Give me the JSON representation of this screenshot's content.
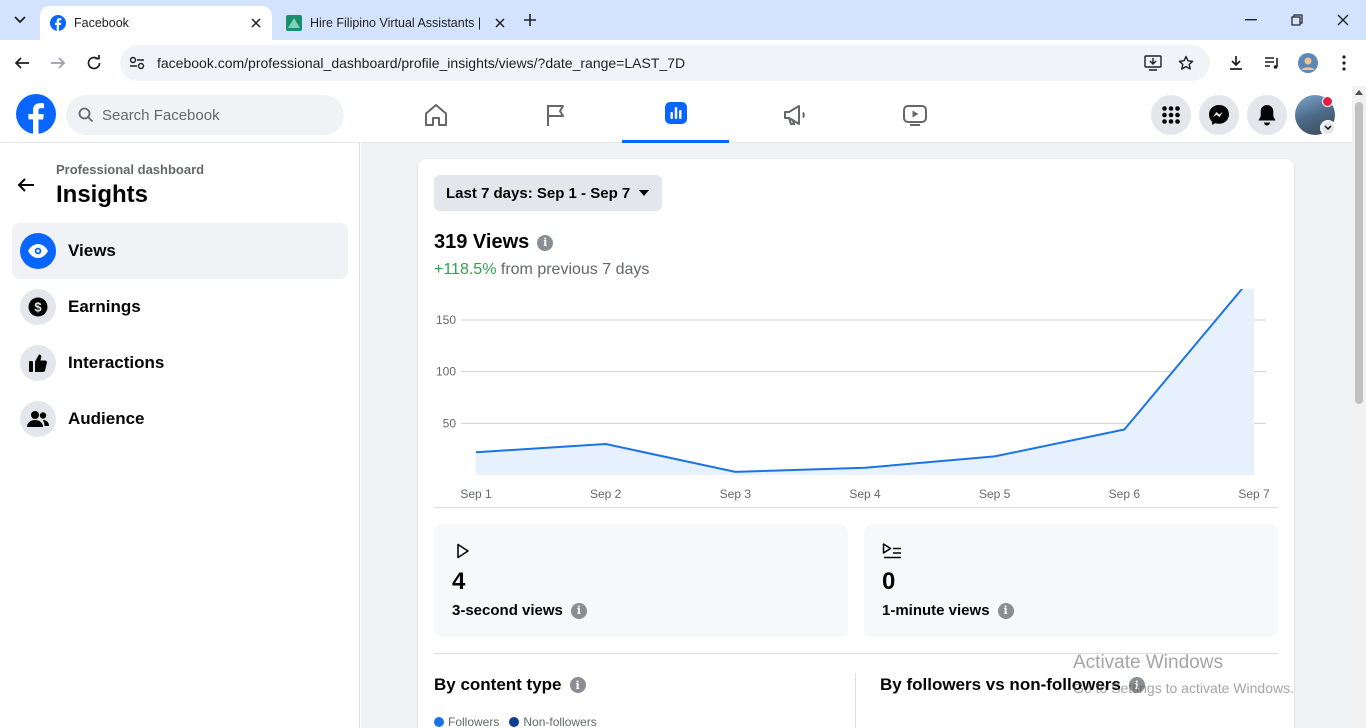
{
  "browser": {
    "tabs": [
      {
        "title": "Facebook",
        "active": true
      },
      {
        "title": "Hire Filipino Virtual Assistants |",
        "active": false
      }
    ],
    "url": "facebook.com/professional_dashboard/profile_insights/views/?date_range=LAST_7D"
  },
  "fb_header": {
    "search_placeholder": "Search Facebook",
    "nav_tabs": [
      "home-icon",
      "flag-icon",
      "insights-icon",
      "megaphone-icon",
      "video-icon"
    ],
    "active_tab": "insights-icon"
  },
  "sidebar": {
    "breadcrumb": "Professional dashboard",
    "title": "Insights",
    "items": [
      {
        "label": "Views",
        "icon": "eye-icon",
        "active": true
      },
      {
        "label": "Earnings",
        "icon": "dollar-icon",
        "active": false
      },
      {
        "label": "Interactions",
        "icon": "thumbs-up-icon",
        "active": false
      },
      {
        "label": "Audience",
        "icon": "people-icon",
        "active": false
      }
    ]
  },
  "main": {
    "date_range_label": "Last 7 days: Sep 1 - Sep 7",
    "views_total": "319 Views",
    "change_pct": "+118.5%",
    "change_text": "from previous 7 days",
    "stats": [
      {
        "value": "4",
        "label": "3-second views",
        "icon": "play-icon"
      },
      {
        "value": "0",
        "label": "1-minute views",
        "icon": "playlist-icon"
      }
    ],
    "by_content_type": "By content type",
    "by_followers": "By followers vs non-followers",
    "legend": [
      "Followers",
      "Non-followers"
    ]
  },
  "colors": {
    "accent": "#0866ff",
    "line": "#1b74e4",
    "area": "#e7f0fd",
    "positive": "#31a24c",
    "non_followers": "#0b3d91"
  },
  "chart_data": {
    "type": "area",
    "categories": [
      "Sep 1",
      "Sep 2",
      "Sep 3",
      "Sep 4",
      "Sep 5",
      "Sep 6",
      "Sep 7"
    ],
    "values": [
      22,
      30,
      3,
      7,
      18,
      44,
      194
    ],
    "yticks": [
      50,
      100,
      150
    ],
    "ylim": [
      0,
      180
    ],
    "grid": true
  },
  "watermark": {
    "line1": "Activate Windows",
    "line2": "Go to Settings to activate Windows."
  }
}
